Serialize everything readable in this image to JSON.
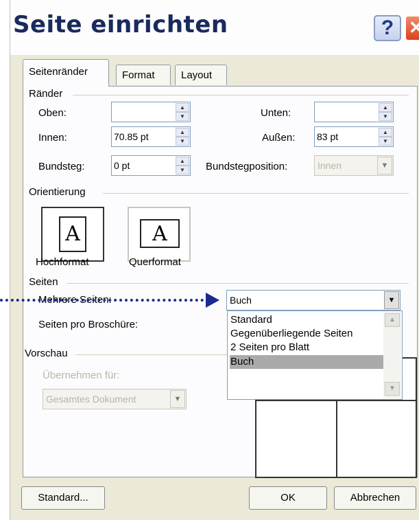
{
  "window": {
    "title": "Seite einrichten"
  },
  "tabs": [
    {
      "label": "Seitenränder"
    },
    {
      "label": "Format"
    },
    {
      "label": "Layout"
    }
  ],
  "margins": {
    "group_label": "Ränder",
    "oben_label": "Oben:",
    "oben_value": "",
    "unten_label": "Unten:",
    "unten_value": "",
    "innen_label": "Innen:",
    "innen_value": "70.85 pt",
    "aussen_label": "Außen:",
    "aussen_value": "83 pt",
    "bundsteg_label": "Bundsteg:",
    "bundsteg_value": "0 pt",
    "bundstegposition_label": "Bundstegposition:",
    "bundstegposition_value": "Innen"
  },
  "orientation": {
    "group_label": "Orientierung",
    "portrait_label": "Hochformat",
    "landscape_label": "Querformat",
    "glyph": "A"
  },
  "pages": {
    "group_label": "Seiten",
    "mehrere_label": "Mehrere Seiten:",
    "mehrere_value": "Buch",
    "broschuere_label": "Seiten pro Broschüre:",
    "options": [
      "Standard",
      "Gegenüberliegende Seiten",
      "2 Seiten pro Blatt",
      "Buch"
    ],
    "selected_option": "Buch"
  },
  "preview": {
    "group_label": "Vorschau",
    "apply_label": "Übernehmen für:",
    "apply_value": "Gesamtes Dokument"
  },
  "buttons": {
    "standard": "Standard...",
    "ok": "OK",
    "cancel": "Abbrechen"
  },
  "colors": {
    "dialog_bg": "#ece9d8",
    "title_color": "#1a2a5e",
    "arrow_color": "#1a2b8f",
    "close_button": "#d8431c"
  },
  "icons": {
    "help": "?",
    "close": "close-icon"
  }
}
